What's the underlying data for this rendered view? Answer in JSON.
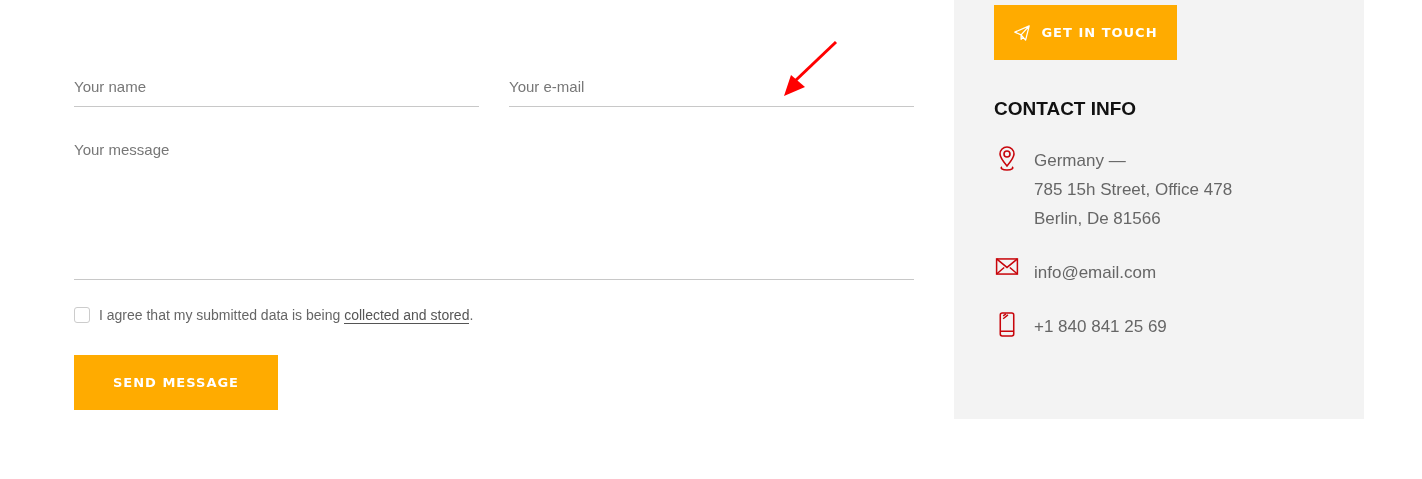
{
  "form": {
    "name_field": {
      "placeholder": "Your name"
    },
    "email_field": {
      "placeholder": "Your e-mail"
    },
    "message_field": {
      "placeholder": "Your message"
    },
    "consent": {
      "checked": false,
      "text": "I agree that my submitted data is being ",
      "link": "collected and stored",
      "end": "."
    },
    "submit": "SEND MESSAGE"
  },
  "sidebar": {
    "button": "GET IN TOUCH",
    "heading": "CONTACT INFO",
    "items": [
      {
        "kind": "address",
        "lines": [
          "Germany —",
          "785 15h Street, Office 478",
          "Berlin, De 81566"
        ]
      },
      {
        "kind": "email",
        "lines": [
          "info@email.com"
        ]
      },
      {
        "kind": "phone",
        "lines": [
          "+1 840 841 25 69"
        ]
      }
    ]
  }
}
